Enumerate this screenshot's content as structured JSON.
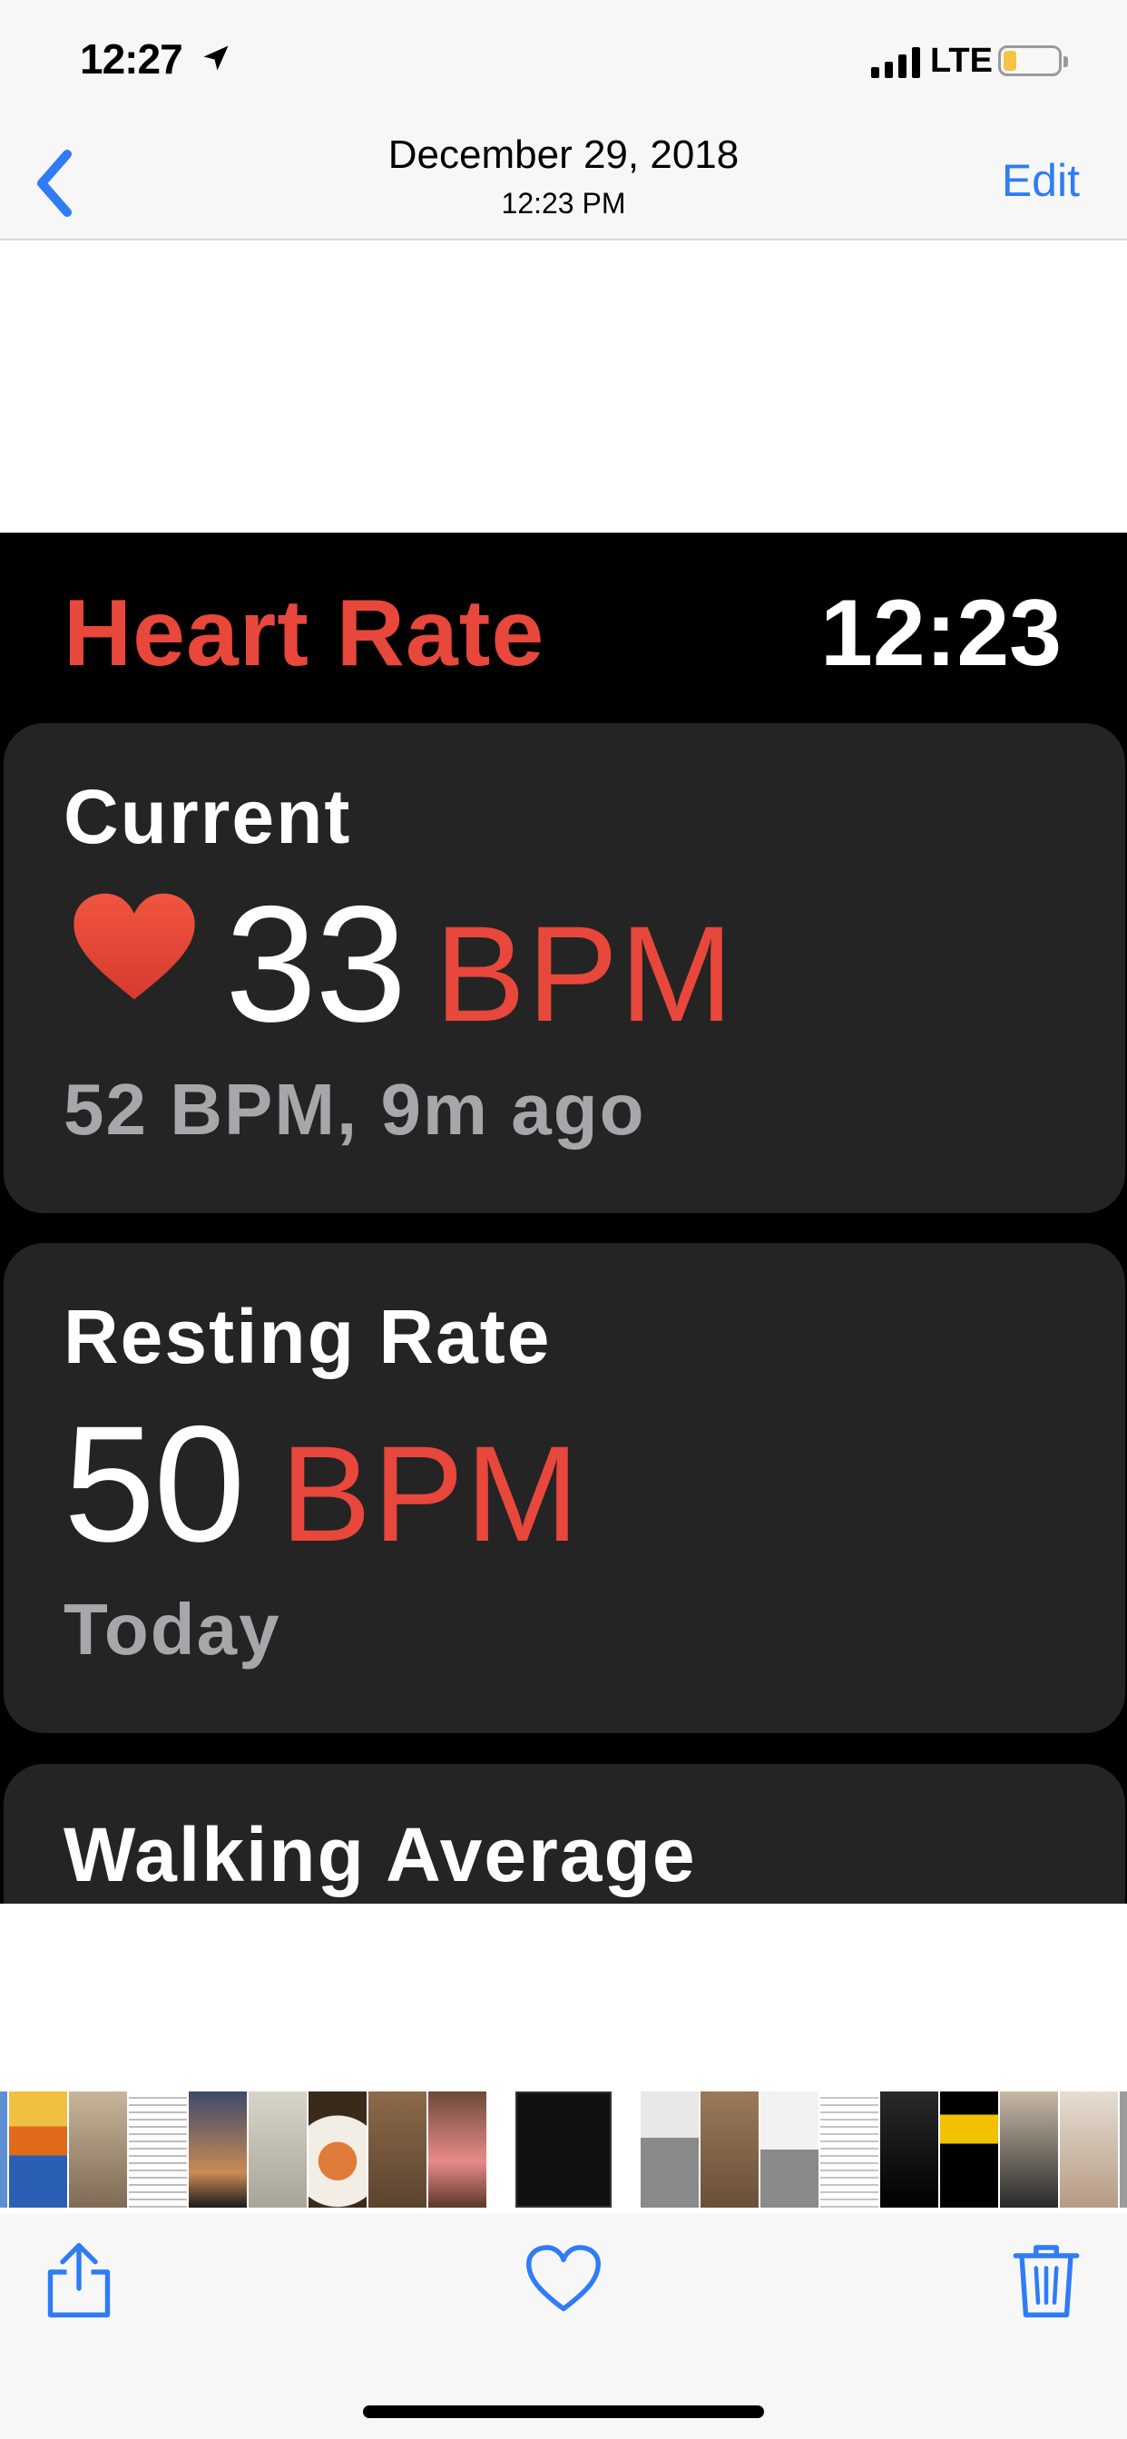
{
  "status_bar": {
    "time": "12:27",
    "network": "LTE",
    "icons": [
      "location-arrow-icon",
      "signal-bars-icon",
      "battery-low-icon"
    ]
  },
  "nav": {
    "date": "December 29, 2018",
    "time": "12:23 PM",
    "edit_label": "Edit",
    "back_icon": "chevron-left-icon"
  },
  "watch_screen": {
    "title": "Heart Rate",
    "clock": "12:23",
    "current": {
      "label": "Current",
      "value": "33",
      "unit": "BPM",
      "subtitle": "52 BPM, 9m ago",
      "icon": "heart-icon"
    },
    "resting": {
      "label": "Resting Rate",
      "value": "50",
      "unit": "BPM",
      "subtitle": "Today"
    },
    "walking": {
      "label": "Walking Average"
    }
  },
  "toolbar": {
    "share_icon": "share-icon",
    "favorite_icon": "heart-outline-icon",
    "delete_icon": "trash-icon"
  },
  "colors": {
    "accent_blue": "#2f7cf6",
    "heart_red": "#e8473b",
    "card_bg": "#242424",
    "subtitle_gray": "#a6a6ab"
  }
}
